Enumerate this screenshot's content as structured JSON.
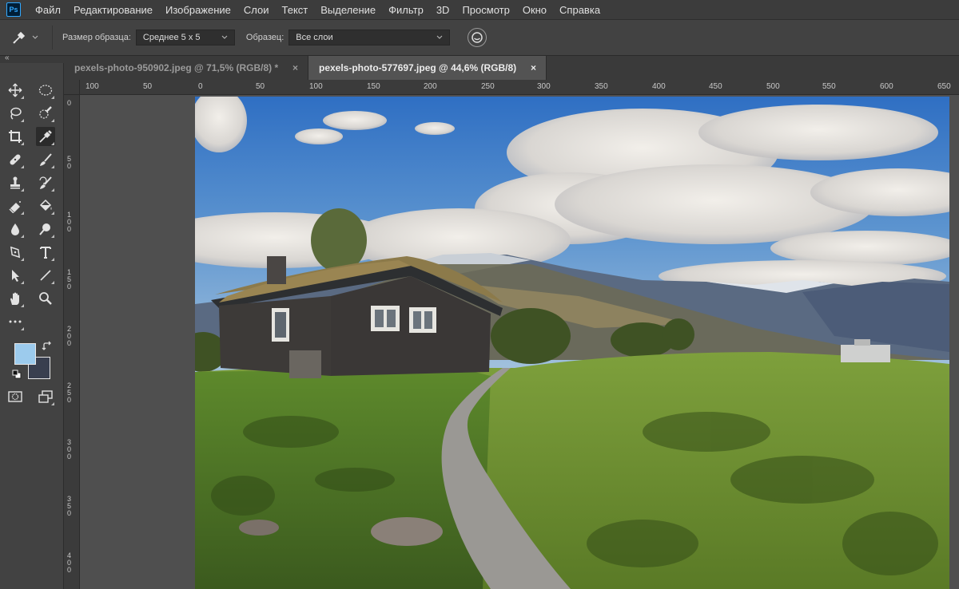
{
  "menu": {
    "logo": "Ps",
    "items": [
      "Файл",
      "Редактирование",
      "Изображение",
      "Слои",
      "Текст",
      "Выделение",
      "Фильтр",
      "3D",
      "Просмотр",
      "Окно",
      "Справка"
    ]
  },
  "options": {
    "sample_size_label": "Размер образца:",
    "sample_size_value": "Среднее 5 x 5",
    "sample_label": "Образец:",
    "sample_value": "Все слои"
  },
  "panel_collapse": "«",
  "tabs": [
    {
      "title": "pexels-photo-950902.jpeg @ 71,5% (RGB/8) *",
      "close": "×",
      "active": false
    },
    {
      "title": "pexels-photo-577697.jpeg @ 44,6% (RGB/8)",
      "close": "×",
      "active": true
    }
  ],
  "ruler_top_labels": [
    "100",
    "50",
    "0",
    "50",
    "100",
    "150",
    "200",
    "250",
    "300",
    "350",
    "400",
    "450",
    "500",
    "550",
    "600",
    "650"
  ],
  "ruler_left_labels": [
    "0",
    "50",
    "100",
    "150",
    "200",
    "250",
    "300",
    "350",
    "400"
  ],
  "colors": {
    "foreground": "#9ccbed",
    "background": "#393f4f",
    "app_bg": "#535353",
    "panel": "#424242"
  },
  "tools": [
    "move-icon",
    "marquee-icon",
    "lasso-icon",
    "quick-select-icon",
    "crop-icon",
    "eyedropper-icon",
    "healing-icon",
    "brush-icon",
    "stamp-icon",
    "history-brush-icon",
    "eraser-icon",
    "paint-bucket-icon",
    "blur-icon",
    "dodge-icon",
    "pen-icon",
    "type-icon",
    "path-select-icon",
    "line-icon",
    "hand-icon",
    "zoom-icon",
    "more-icon",
    "quick-mask-icon",
    "screen-mode-icon"
  ]
}
